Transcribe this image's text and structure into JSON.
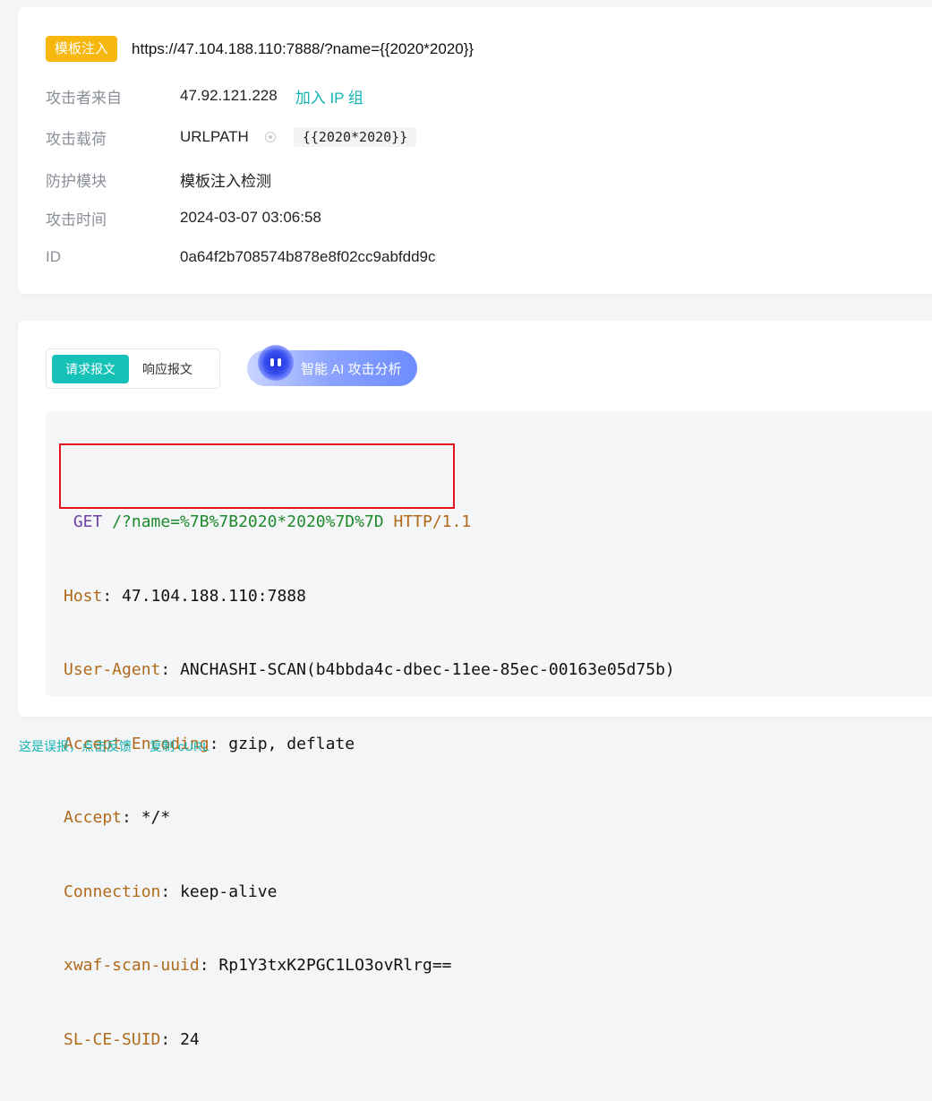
{
  "attack": {
    "type_badge": "模板注入",
    "url": "https://47.104.188.110:7888/?name={{2020*2020}}"
  },
  "info": {
    "source_label": "攻击者来自",
    "source_ip": "47.92.121.228",
    "add_ip_group": "加入 IP 组",
    "payload_label": "攻击载荷",
    "payload_location": "URLPATH",
    "payload_value": "{{2020*2020}}",
    "module_label": "防护模块",
    "module_value": "模板注入检测",
    "time_label": "攻击时间",
    "time_value": "2024-03-07 03:06:58",
    "id_label": "ID",
    "id_value": "0a64f2b708574b878e8f02cc9abfdd9c"
  },
  "tabs": {
    "request": "请求报文",
    "response": "响应报文"
  },
  "ai_button": "智能 AI 攻击分析",
  "request_packet": {
    "method": "GET",
    "path": "/?name=%7B%7B2020*2020%7D%7D",
    "protocol": "HTTP/1.1",
    "headers": [
      {
        "key": "Host",
        "value": "47.104.188.110:7888"
      },
      {
        "key": "User-Agent",
        "value": "ANCHASHI-SCAN(b4bbda4c-dbec-11ee-85ec-00163e05d75b)"
      },
      {
        "key": "Accept-Encoding",
        "value": "gzip, deflate"
      },
      {
        "key": "Accept",
        "value": "*/*"
      },
      {
        "key": "Connection",
        "value": "keep-alive"
      },
      {
        "key": "xwaf-scan-uuid",
        "value": "Rp1Y3txK2PGC1LO3ovRlrg=="
      },
      {
        "key": "SL-CE-SUID",
        "value": "24"
      }
    ]
  },
  "footer": {
    "false_positive": "这是误报，点击反馈",
    "copy_curl": "复制 cURL"
  },
  "colors": {
    "accent": "#16c1b8",
    "badge": "#f6b70f",
    "highlight": "#e3121b"
  }
}
